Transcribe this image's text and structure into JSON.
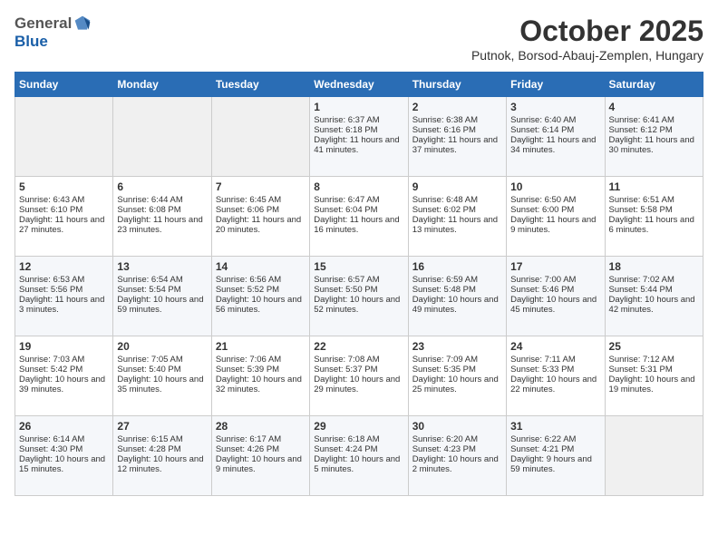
{
  "header": {
    "logo_general": "General",
    "logo_blue": "Blue",
    "title": "October 2025",
    "subtitle": "Putnok, Borsod-Abauj-Zemplen, Hungary"
  },
  "days_of_week": [
    "Sunday",
    "Monday",
    "Tuesday",
    "Wednesday",
    "Thursday",
    "Friday",
    "Saturday"
  ],
  "weeks": [
    [
      {
        "day": "",
        "empty": true
      },
      {
        "day": "",
        "empty": true
      },
      {
        "day": "",
        "empty": true
      },
      {
        "day": "1",
        "sunrise": "6:37 AM",
        "sunset": "6:18 PM",
        "daylight": "11 hours and 41 minutes."
      },
      {
        "day": "2",
        "sunrise": "6:38 AM",
        "sunset": "6:16 PM",
        "daylight": "11 hours and 37 minutes."
      },
      {
        "day": "3",
        "sunrise": "6:40 AM",
        "sunset": "6:14 PM",
        "daylight": "11 hours and 34 minutes."
      },
      {
        "day": "4",
        "sunrise": "6:41 AM",
        "sunset": "6:12 PM",
        "daylight": "11 hours and 30 minutes."
      }
    ],
    [
      {
        "day": "5",
        "sunrise": "6:43 AM",
        "sunset": "6:10 PM",
        "daylight": "11 hours and 27 minutes."
      },
      {
        "day": "6",
        "sunrise": "6:44 AM",
        "sunset": "6:08 PM",
        "daylight": "11 hours and 23 minutes."
      },
      {
        "day": "7",
        "sunrise": "6:45 AM",
        "sunset": "6:06 PM",
        "daylight": "11 hours and 20 minutes."
      },
      {
        "day": "8",
        "sunrise": "6:47 AM",
        "sunset": "6:04 PM",
        "daylight": "11 hours and 16 minutes."
      },
      {
        "day": "9",
        "sunrise": "6:48 AM",
        "sunset": "6:02 PM",
        "daylight": "11 hours and 13 minutes."
      },
      {
        "day": "10",
        "sunrise": "6:50 AM",
        "sunset": "6:00 PM",
        "daylight": "11 hours and 9 minutes."
      },
      {
        "day": "11",
        "sunrise": "6:51 AM",
        "sunset": "5:58 PM",
        "daylight": "11 hours and 6 minutes."
      }
    ],
    [
      {
        "day": "12",
        "sunrise": "6:53 AM",
        "sunset": "5:56 PM",
        "daylight": "11 hours and 3 minutes."
      },
      {
        "day": "13",
        "sunrise": "6:54 AM",
        "sunset": "5:54 PM",
        "daylight": "10 hours and 59 minutes."
      },
      {
        "day": "14",
        "sunrise": "6:56 AM",
        "sunset": "5:52 PM",
        "daylight": "10 hours and 56 minutes."
      },
      {
        "day": "15",
        "sunrise": "6:57 AM",
        "sunset": "5:50 PM",
        "daylight": "10 hours and 52 minutes."
      },
      {
        "day": "16",
        "sunrise": "6:59 AM",
        "sunset": "5:48 PM",
        "daylight": "10 hours and 49 minutes."
      },
      {
        "day": "17",
        "sunrise": "7:00 AM",
        "sunset": "5:46 PM",
        "daylight": "10 hours and 45 minutes."
      },
      {
        "day": "18",
        "sunrise": "7:02 AM",
        "sunset": "5:44 PM",
        "daylight": "10 hours and 42 minutes."
      }
    ],
    [
      {
        "day": "19",
        "sunrise": "7:03 AM",
        "sunset": "5:42 PM",
        "daylight": "10 hours and 39 minutes."
      },
      {
        "day": "20",
        "sunrise": "7:05 AM",
        "sunset": "5:40 PM",
        "daylight": "10 hours and 35 minutes."
      },
      {
        "day": "21",
        "sunrise": "7:06 AM",
        "sunset": "5:39 PM",
        "daylight": "10 hours and 32 minutes."
      },
      {
        "day": "22",
        "sunrise": "7:08 AM",
        "sunset": "5:37 PM",
        "daylight": "10 hours and 29 minutes."
      },
      {
        "day": "23",
        "sunrise": "7:09 AM",
        "sunset": "5:35 PM",
        "daylight": "10 hours and 25 minutes."
      },
      {
        "day": "24",
        "sunrise": "7:11 AM",
        "sunset": "5:33 PM",
        "daylight": "10 hours and 22 minutes."
      },
      {
        "day": "25",
        "sunrise": "7:12 AM",
        "sunset": "5:31 PM",
        "daylight": "10 hours and 19 minutes."
      }
    ],
    [
      {
        "day": "26",
        "sunrise": "6:14 AM",
        "sunset": "4:30 PM",
        "daylight": "10 hours and 15 minutes."
      },
      {
        "day": "27",
        "sunrise": "6:15 AM",
        "sunset": "4:28 PM",
        "daylight": "10 hours and 12 minutes."
      },
      {
        "day": "28",
        "sunrise": "6:17 AM",
        "sunset": "4:26 PM",
        "daylight": "10 hours and 9 minutes."
      },
      {
        "day": "29",
        "sunrise": "6:18 AM",
        "sunset": "4:24 PM",
        "daylight": "10 hours and 5 minutes."
      },
      {
        "day": "30",
        "sunrise": "6:20 AM",
        "sunset": "4:23 PM",
        "daylight": "10 hours and 2 minutes."
      },
      {
        "day": "31",
        "sunrise": "6:22 AM",
        "sunset": "4:21 PM",
        "daylight": "9 hours and 59 minutes."
      },
      {
        "day": "",
        "empty": true
      }
    ]
  ],
  "labels": {
    "sunrise": "Sunrise:",
    "sunset": "Sunset:",
    "daylight": "Daylight:"
  }
}
